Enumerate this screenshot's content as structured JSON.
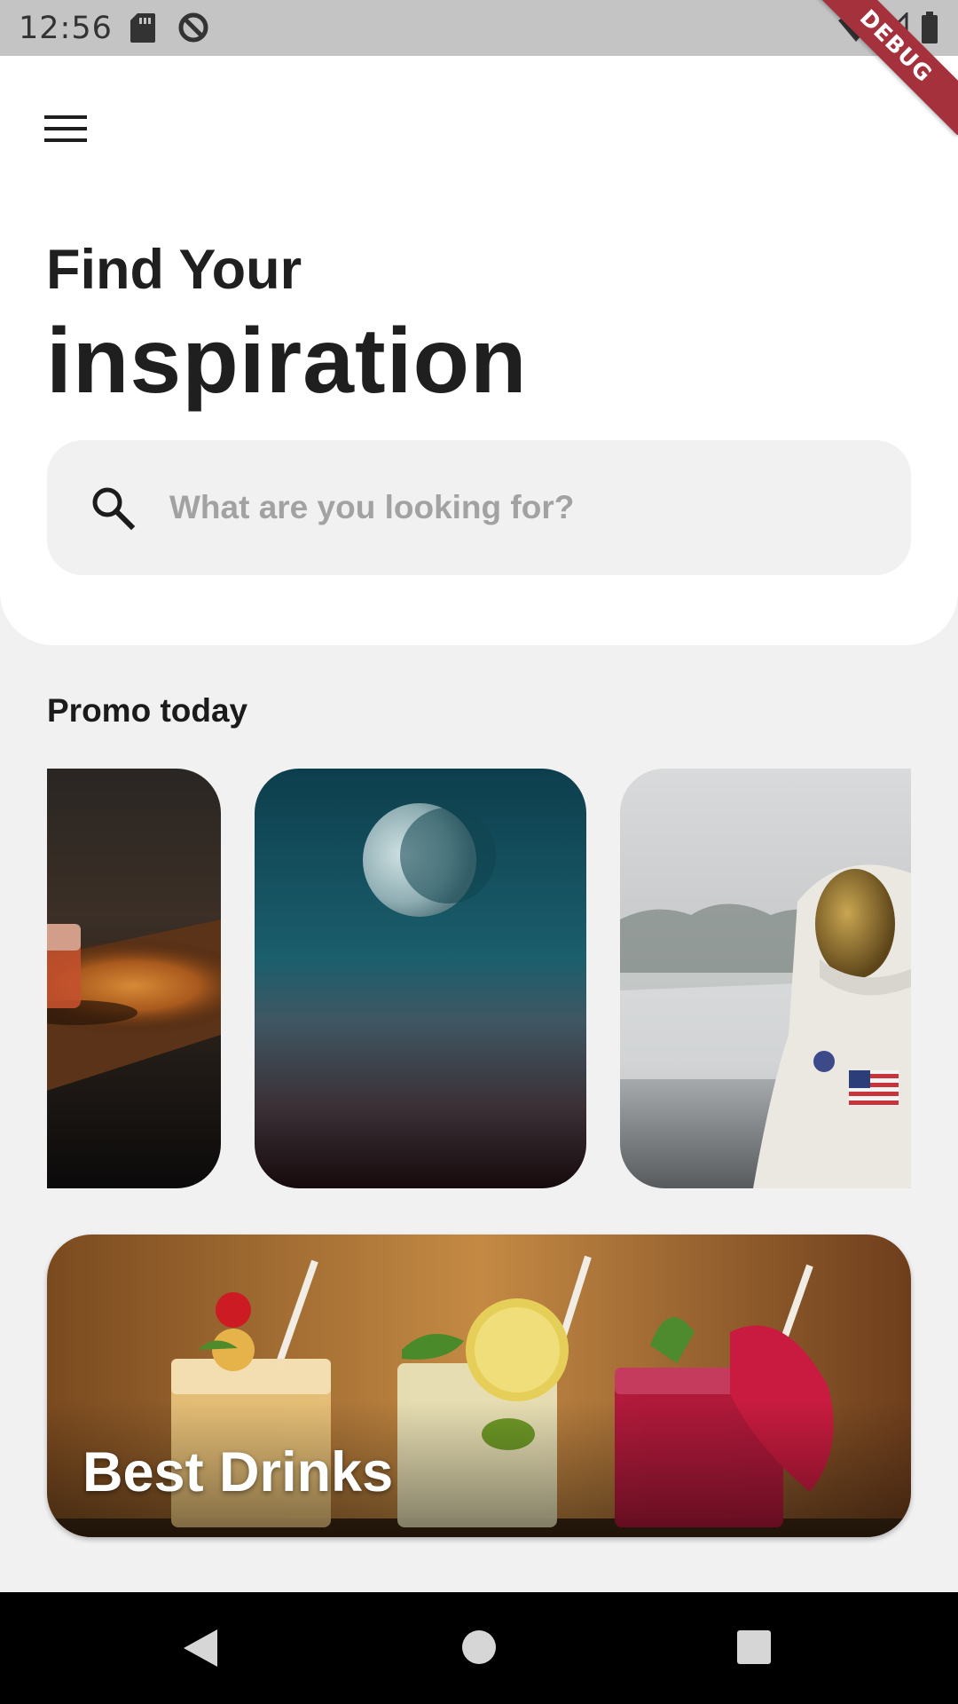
{
  "status_bar": {
    "time": "12:56",
    "debug_label": "DEBUG",
    "icons": [
      "sd-card-icon",
      "data-saver-icon",
      "wifi-icon",
      "signal-icon",
      "battery-icon"
    ]
  },
  "header": {
    "menu_icon": "menu-icon",
    "headline_small": "Find Your",
    "headline_large": "inspiration"
  },
  "search": {
    "placeholder": "What are you looking for?",
    "value": "",
    "icon": "search-icon"
  },
  "promo": {
    "title": "Promo today",
    "cards": [
      {
        "subject": "drink-on-table-image"
      },
      {
        "subject": "moon-night-sky-image"
      },
      {
        "subject": "astronaut-image"
      }
    ]
  },
  "banner": {
    "title": "Best Drinks",
    "image": "cocktails-image"
  },
  "nav_bar": {
    "buttons": [
      "back-icon",
      "home-icon",
      "recents-icon"
    ]
  },
  "colors": {
    "background": "#f2f1f2",
    "card_background": "#ffffff",
    "text_primary": "#1f1f1f",
    "placeholder": "#a2a2a2",
    "debug_ribbon": "#a5313d"
  }
}
